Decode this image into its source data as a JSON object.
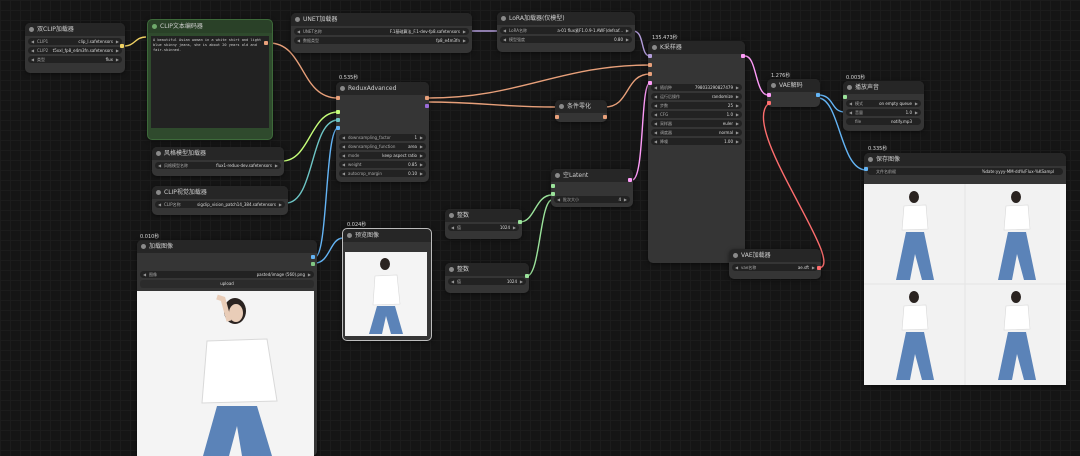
{
  "nodes": {
    "dual_clip": {
      "title": "双CLIP加载器",
      "widgets": [
        {
          "label": "CLIP1",
          "value": "clip_l.safetensors"
        },
        {
          "label": "CLIP2",
          "value": "t5xxl_fp8_e4m3fn.safetensors"
        },
        {
          "label": "类型",
          "value": "flux"
        }
      ]
    },
    "clip_text": {
      "title": "CLIP文本编码器",
      "text": "A beautiful Asian woman in a white shirt and light blue skinny jeans, she is about 20 years old and fair-skinned."
    },
    "unet": {
      "title": "UNET加载器",
      "widgets": [
        {
          "label": "UNET名称",
          "value": "F.1基础算法_F.1-dev-fp8.safetensors"
        },
        {
          "label": "数据类型",
          "value": "fp8_e4m3fn"
        }
      ]
    },
    "lora": {
      "title": "LoRA加载器(仅模型)",
      "widgets": [
        {
          "label": "LoRA名称",
          "value": "a-01 flux紧F1.0.9-1.AWF(defsaf..."
        },
        {
          "label": "模型强度",
          "value": "0.80"
        }
      ]
    },
    "redux": {
      "timer": "0.535秒",
      "title": "ReduxAdvanced",
      "widgets": [
        {
          "label": "downsampling_factor",
          "value": "1"
        },
        {
          "label": "downsampling_function",
          "value": "area"
        },
        {
          "label": "mode",
          "value": "keep aspect ratio"
        },
        {
          "label": "weight",
          "value": "0.85"
        },
        {
          "label": "autocrop_margin",
          "value": "0.10"
        }
      ]
    },
    "style_model": {
      "title": "风格模型加载器",
      "widgets": [
        {
          "label": "风格模型名称",
          "value": "flux1-redux-dev.safetensors"
        }
      ]
    },
    "clip_vision": {
      "title": "CLIP视觉加载器",
      "widgets": [
        {
          "label": "CLIP名称",
          "value": "sigclip_vision_patch14_384.safetensors"
        }
      ]
    },
    "load_image": {
      "timer": "0.010秒",
      "title": "加载图像",
      "widgets": [
        {
          "label": "图像",
          "value": "pasted/image (560).png"
        }
      ],
      "upload": "upload"
    },
    "preview": {
      "timer": "0.024秒",
      "title": "预览图像"
    },
    "cond_zero": {
      "title": "条件零化"
    },
    "empty_latent": {
      "title": "空Latent",
      "widgets": [
        {
          "label": "批次大小",
          "value": "4"
        }
      ]
    },
    "width": {
      "title": "整数",
      "widgets": [
        {
          "label": "值",
          "value": "1024"
        }
      ]
    },
    "height": {
      "title": "整数",
      "widgets": [
        {
          "label": "值",
          "value": "1024"
        }
      ]
    },
    "ksampler": {
      "timer": "135.473秒",
      "title": "K采样器",
      "widgets": [
        {
          "label": "随机种",
          "value": "798033290827479"
        },
        {
          "label": "运行后操作",
          "value": "randomize"
        },
        {
          "label": "步数",
          "value": "25"
        },
        {
          "label": "CFG",
          "value": "1.0"
        },
        {
          "label": "采样器",
          "value": "euler"
        },
        {
          "label": "调度器",
          "value": "normal"
        },
        {
          "label": "降噪",
          "value": "1.00"
        }
      ]
    },
    "vae_decode": {
      "timer": "1.276秒",
      "title": "VAE解码"
    },
    "vae_loader": {
      "title": "VAE加载器",
      "widgets": [
        {
          "label": "vae名称",
          "value": "ae.sft"
        }
      ]
    },
    "play_sound": {
      "timer": "0.003秒",
      "title": "播放声音",
      "widgets": [
        {
          "label": "模式",
          "value": "on empty queue"
        },
        {
          "label": "音量",
          "value": "1.0"
        },
        {
          "label": "file",
          "value": "notify.mp3"
        }
      ]
    },
    "save_image": {
      "timer": "0.335秒",
      "title": "保存图像",
      "widgets": [
        {
          "label": "文件名前缀",
          "value": "%date:yyyy-MM-dd%/Flux-%KSampl"
        }
      ]
    }
  },
  "colors": {
    "canvas": "#151515",
    "node": "#353535",
    "title": "#262626",
    "clip_node": "#2f4a2d",
    "conditioning_wire": "#e8a07a",
    "model_wire": "#b39ddb",
    "clip_wire": "#f0d264",
    "vae_wire": "#ff6e6e",
    "image_wire": "#64b5f6",
    "int_wire": "#9be39b",
    "latent_wire": "#ff9cf9",
    "stylemodel_wire": "#c6ff7a"
  }
}
